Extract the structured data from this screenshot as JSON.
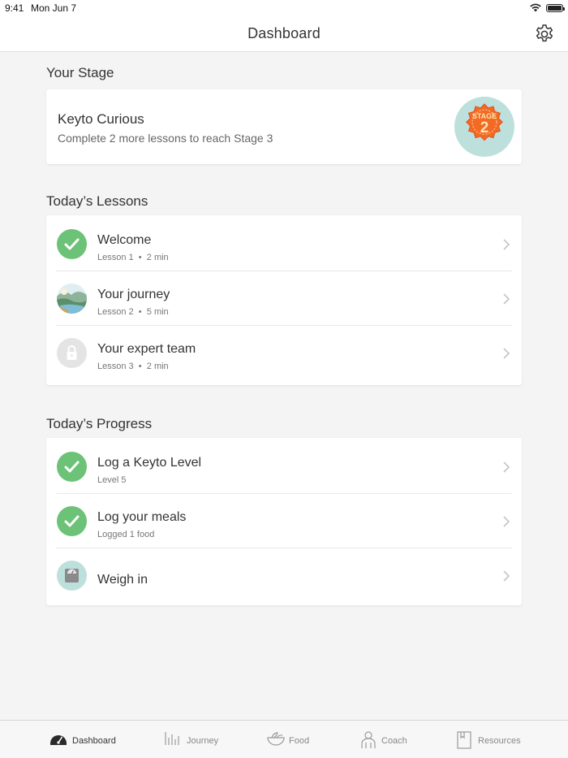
{
  "status_bar": {
    "time": "9:41",
    "date": "Mon Jun 7"
  },
  "nav": {
    "title": "Dashboard"
  },
  "stage_section": {
    "title": "Your Stage",
    "stage_name": "Keyto Curious",
    "stage_subtitle": "Complete 2 more lessons to reach Stage 3",
    "badge_label": "STAGE",
    "badge_number": "2"
  },
  "lessons_section": {
    "title": "Today’s Lessons",
    "items": [
      {
        "title": "Welcome",
        "lesson": "Lesson 1",
        "duration": "2 min",
        "state": "completed"
      },
      {
        "title": "Your journey",
        "lesson": "Lesson 2",
        "duration": "5 min",
        "state": "current"
      },
      {
        "title": "Your expert team",
        "lesson": "Lesson 3",
        "duration": "2 min",
        "state": "locked"
      }
    ],
    "separator": "•"
  },
  "progress_section": {
    "title": "Today’s Progress",
    "items": [
      {
        "title": "Log a Keyto Level",
        "subtitle": "Level 5",
        "state": "completed"
      },
      {
        "title": "Log your meals",
        "subtitle": "Logged 1 food",
        "state": "completed"
      },
      {
        "title": "Weigh in",
        "subtitle": "",
        "state": "pending"
      }
    ]
  },
  "tabs": [
    {
      "label": "Dashboard",
      "icon": "speedometer-icon",
      "active": true
    },
    {
      "label": "Journey",
      "icon": "bars-icon",
      "active": false
    },
    {
      "label": "Food",
      "icon": "bowl-icon",
      "active": false
    },
    {
      "label": "Coach",
      "icon": "person-icon",
      "active": false
    },
    {
      "label": "Resources",
      "icon": "bookmark-book-icon",
      "active": false
    }
  ],
  "colors": {
    "success_green": "#6cc276",
    "badge_orange": "#f26a24",
    "badge_ring": "#bde0dd",
    "background": "#f4f4f4"
  }
}
